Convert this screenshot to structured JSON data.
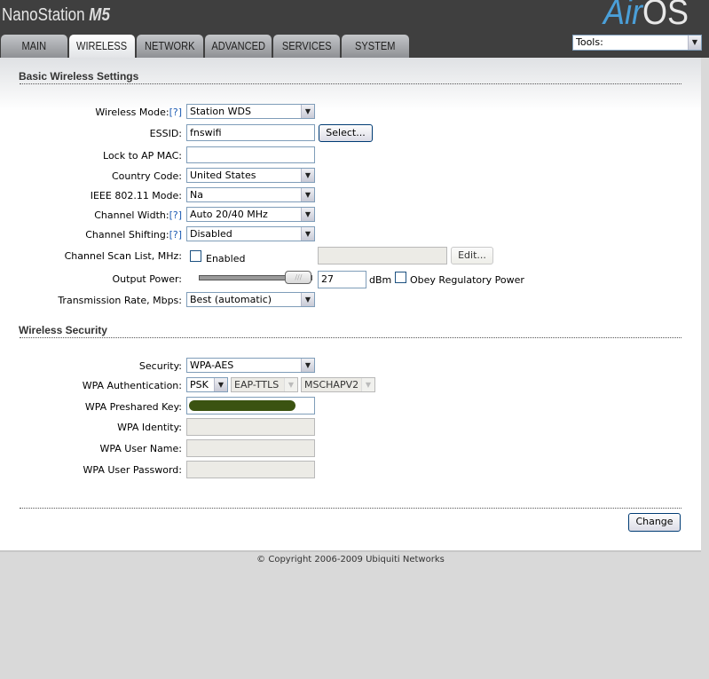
{
  "header": {
    "product_name": "NanoStation",
    "product_model": "M5",
    "brand_logo": {
      "air": "Air",
      "os": "OS"
    }
  },
  "tabs": [
    {
      "label": "MAIN",
      "active": false
    },
    {
      "label": "WIRELESS",
      "active": true
    },
    {
      "label": "NETWORK",
      "active": false
    },
    {
      "label": "ADVANCED",
      "active": false
    },
    {
      "label": "SERVICES",
      "active": false
    },
    {
      "label": "SYSTEM",
      "active": false
    }
  ],
  "tools": {
    "selected": "Tools:"
  },
  "basic": {
    "title": "Basic Wireless Settings",
    "help": "[?]",
    "wireless_mode": {
      "label": "Wireless Mode:",
      "value": "Station WDS"
    },
    "essid": {
      "label": "ESSID:",
      "value": "fnswifi",
      "button": "Select..."
    },
    "lock_ap_mac": {
      "label": "Lock to AP MAC:",
      "value": ""
    },
    "country": {
      "label": "Country Code:",
      "value": "United States"
    },
    "ieee_mode": {
      "label": "IEEE 802.11 Mode:",
      "value": "Na"
    },
    "channel_width": {
      "label": "Channel Width:",
      "value": "Auto 20/40 MHz"
    },
    "channel_shifting": {
      "label": "Channel Shifting:",
      "value": "Disabled"
    },
    "scan_list": {
      "label": "Channel Scan List, MHz:",
      "checkbox_label": "Enabled",
      "checked": false,
      "value": "",
      "button": "Edit..."
    },
    "output_power": {
      "label": "Output Power:",
      "value": "27",
      "unit": "dBm",
      "slider_level": 0.87,
      "obey_label": "Obey Regulatory Power",
      "obey_checked": false
    },
    "tx_rate": {
      "label": "Transmission Rate, Mbps:",
      "value": "Best (automatic)"
    }
  },
  "security": {
    "title": "Wireless Security",
    "security": {
      "label": "Security:",
      "value": "WPA-AES"
    },
    "wpa_auth": {
      "label": "WPA Authentication:",
      "value": "PSK",
      "eap": "EAP-TTLS",
      "inner": "MSCHAPV2"
    },
    "psk": {
      "label": "WPA Preshared Key:"
    },
    "identity": {
      "label": "WPA Identity:",
      "value": ""
    },
    "username": {
      "label": "WPA User Name:",
      "value": ""
    },
    "password": {
      "label": "WPA User Password:",
      "value": ""
    }
  },
  "actions": {
    "change": "Change"
  },
  "footer": {
    "copyright": "© Copyright 2006-2009 Ubiquiti Networks"
  },
  "colors": {
    "header_bg": "#3f3f3f",
    "accent_blue": "#4a9fd8",
    "psk_mask": "#3b5311"
  }
}
